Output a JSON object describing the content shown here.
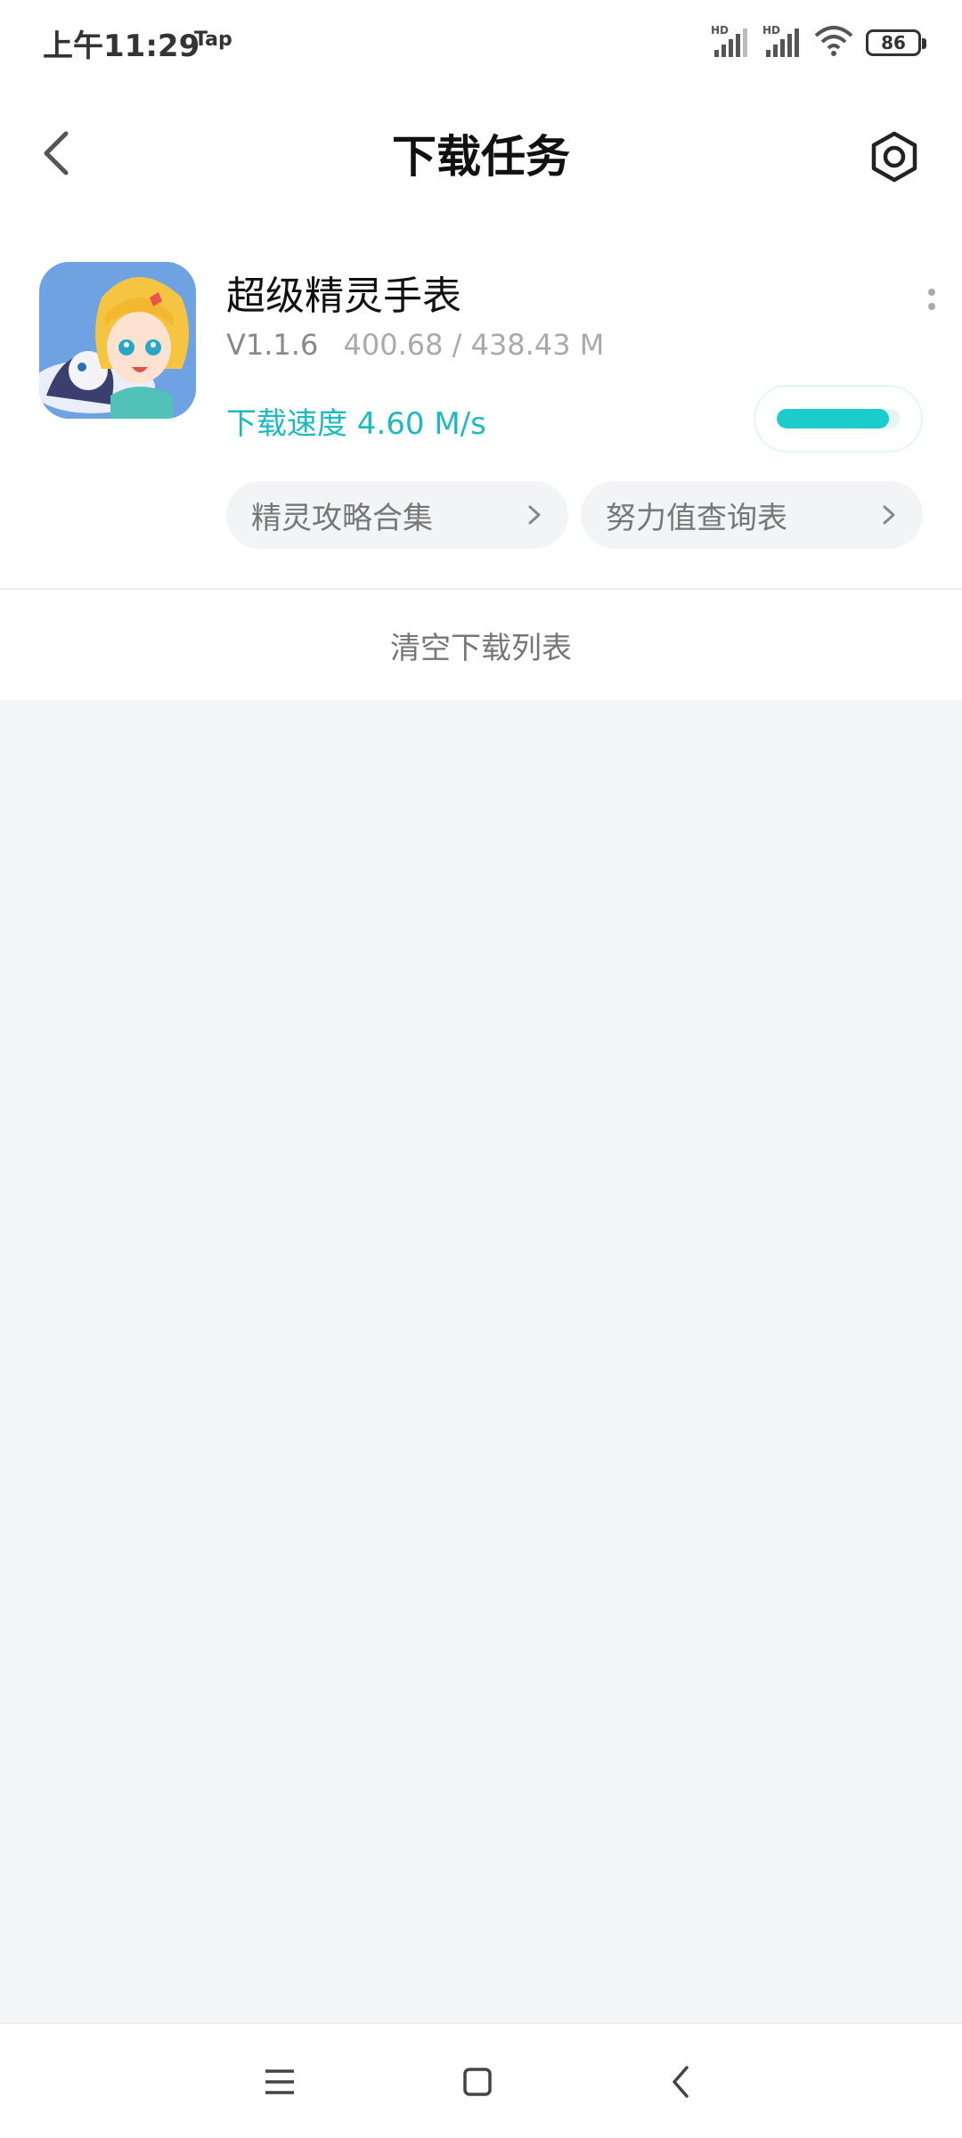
{
  "status": {
    "time": "上午11:29",
    "app": "Tap",
    "battery": "86",
    "network_label": "HD"
  },
  "header": {
    "title": "下载任务",
    "back_icon": "chevron-left-icon",
    "settings_icon": "hexagon-settings-icon"
  },
  "download": {
    "app_name": "超级精灵手表",
    "version": "V1.1.6",
    "size": "400.68 / 438.43 M",
    "speed": "下载速度 4.60 M/s",
    "progress_fraction": 0.914,
    "links": [
      {
        "label": "精灵攻略合集"
      },
      {
        "label": "努力值查询表"
      }
    ]
  },
  "clear_label": "清空下载列表",
  "colors": {
    "accent": "#1fbac0",
    "progress": "#1ccbcb",
    "background": "#f4f5f7"
  }
}
